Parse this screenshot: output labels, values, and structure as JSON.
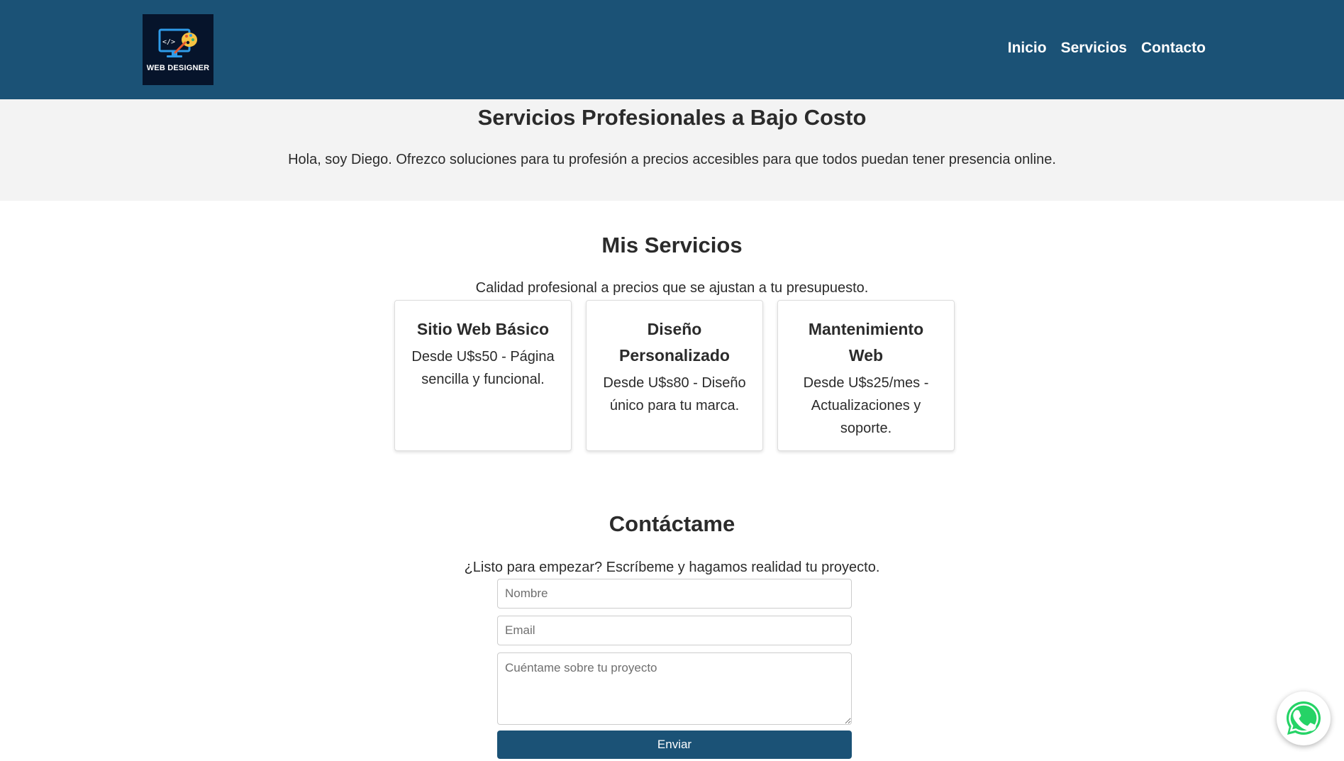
{
  "header": {
    "logo_text": "WEB DESIGNER",
    "nav": [
      {
        "label": "Inicio"
      },
      {
        "label": "Servicios"
      },
      {
        "label": "Contacto"
      }
    ],
    "background_color": "#1b5276"
  },
  "hero": {
    "title": "Servicios Profesionales a Bajo Costo",
    "subtitle": "Hola, soy Diego. Ofrezco soluciones para tu profesión a precios accesibles para que todos puedan tener presencia online."
  },
  "services": {
    "title": "Mis Servicios",
    "subtitle": "Calidad profesional a precios que se ajustan a tu presupuesto.",
    "cards": [
      {
        "title": "Sitio Web Básico",
        "description": "Desde U$s50 - Página sencilla y funcional."
      },
      {
        "title": "Diseño Personalizado",
        "description": "Desde U$s80 - Diseño único para tu marca."
      },
      {
        "title": "Mantenimiento Web",
        "description": "Desde U$s25/mes - Actualizaciones y soporte."
      }
    ]
  },
  "contact": {
    "title": "Contáctame",
    "subtitle": "¿Listo para empezar? Escríbeme y hagamos realidad tu proyecto.",
    "name_placeholder": "Nombre",
    "email_placeholder": "Email",
    "message_placeholder": "Cuéntame sobre tu proyecto",
    "submit_label": "Enviar"
  },
  "floating": {
    "icon": "whatsapp-icon",
    "color": "#25d366"
  }
}
